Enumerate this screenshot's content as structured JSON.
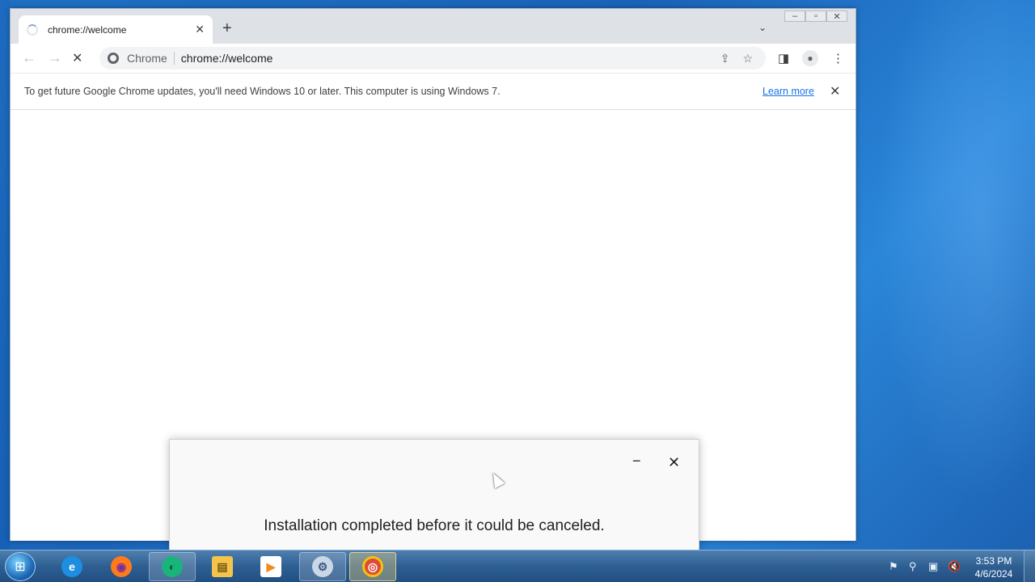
{
  "browser": {
    "tab": {
      "title": "chrome://welcome",
      "close_glyph": "✕"
    },
    "new_tab_glyph": "+",
    "tab_search_glyph": "⌄",
    "window_controls": {
      "minimize": "–",
      "restore": "▫",
      "close": "✕"
    },
    "toolbar": {
      "back_glyph": "←",
      "forward_glyph": "→",
      "stop_glyph": "✕",
      "site_chip": "Chrome",
      "url": "chrome://welcome",
      "share_glyph": "⇪",
      "bookmark_glyph": "☆",
      "side_panel_glyph": "◨",
      "menu_glyph": "⋮"
    },
    "infobar": {
      "message": "To get future Google Chrome updates, you'll need Windows 10 or later. This computer is using Windows 7.",
      "link": "Learn more",
      "close_glyph": "✕"
    }
  },
  "installer": {
    "minimize_glyph": "−",
    "close_glyph": "✕",
    "message": "Installation completed before it could be canceled."
  },
  "taskbar": {
    "start_glyph": "⊞",
    "apps": [
      {
        "name": "Internet Explorer",
        "glyph": "e",
        "color": "#1e8fe0"
      },
      {
        "name": "Firefox",
        "glyph": "◉",
        "color": "#ff7a1a"
      },
      {
        "name": "Green app",
        "glyph": "◐",
        "color": "#19b47a"
      },
      {
        "name": "Explorer",
        "glyph": "▤",
        "color": "#f3c44b"
      },
      {
        "name": "Media Player",
        "glyph": "▶",
        "color": "#f08c1a"
      },
      {
        "name": "Installer",
        "glyph": "⚙",
        "color": "#c9d7e6"
      },
      {
        "name": "Chrome",
        "glyph": "◎",
        "color": "#dd4b39"
      }
    ],
    "tray": {
      "flag": "⚑",
      "search": "⚲",
      "network": "▣",
      "volume": "🔇"
    },
    "clock": {
      "time": "3:53 PM",
      "date": "4/6/2024"
    }
  },
  "colors": {
    "accent": "#1a73e8",
    "taskbar": "#2e5f93",
    "desktop": "#1e6fc2"
  }
}
